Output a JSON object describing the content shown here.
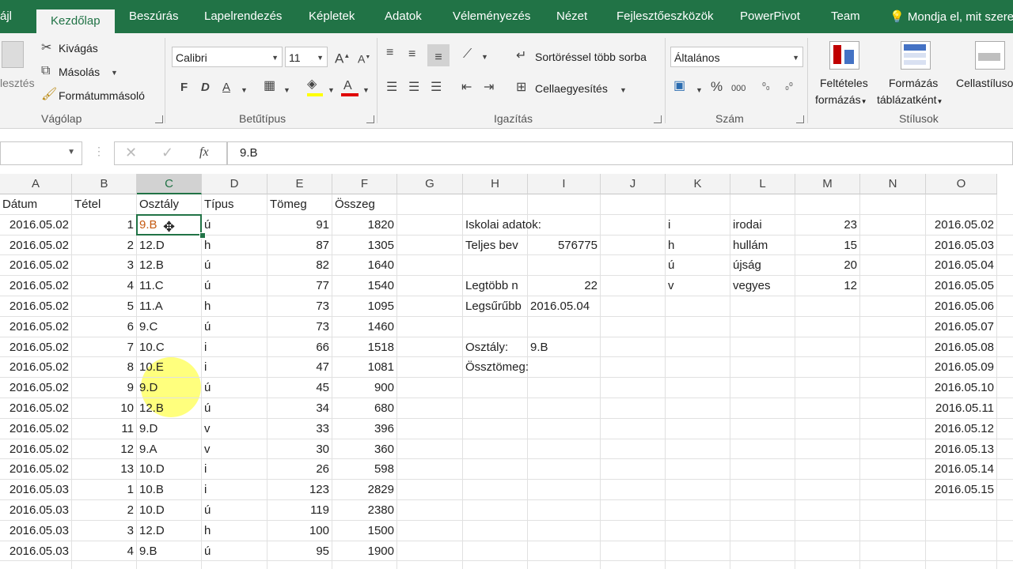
{
  "tabs": [
    "ájl",
    "Kezdőlap",
    "Beszúrás",
    "Lapelrendezés",
    "Képletek",
    "Adatok",
    "Véleményezés",
    "Nézet",
    "Fejlesztőeszközök",
    "PowerPivot",
    "Team"
  ],
  "tell_me": "Mondja el, mit szere",
  "clipboard": {
    "paste": "lesztés",
    "cut": "Kivágás",
    "copy": "Másolás",
    "format_painter": "Formátummásoló",
    "group": "Vágólap"
  },
  "font": {
    "name": "Calibri",
    "size": "11",
    "bold": "F",
    "italic": "D",
    "underline": "A",
    "group": "Betűtípus"
  },
  "alignment": {
    "wrap": "Sortöréssel több sorba",
    "merge": "Cellaegyesítés",
    "group": "Igazítás"
  },
  "number": {
    "format": "Általános",
    "percent": "%",
    "thousands": "000",
    "group": "Szám"
  },
  "styles": {
    "conditional_1": "Feltételes",
    "conditional_2": "formázás",
    "table_1": "Formázás",
    "table_2": "táblázatként",
    "cell": "Cellastílusok",
    "group": "Stílusok"
  },
  "formula_bar": {
    "fx": "fx",
    "value": "9.B"
  },
  "columns": [
    "A",
    "B",
    "C",
    "D",
    "E",
    "F",
    "G",
    "H",
    "I",
    "J",
    "K",
    "L",
    "M",
    "N",
    "O"
  ],
  "selected_column": "C",
  "headers": {
    "A": "Dátum",
    "B": "Tétel",
    "C": "Osztály",
    "D": "Típus",
    "E": "Tömeg",
    "F": "Összeg"
  },
  "rows": [
    [
      "2016.05.02",
      "1",
      "9.B",
      "ú",
      "91",
      "1820"
    ],
    [
      "2016.05.02",
      "2",
      "12.D",
      "h",
      "87",
      "1305"
    ],
    [
      "2016.05.02",
      "3",
      "12.B",
      "ú",
      "82",
      "1640"
    ],
    [
      "2016.05.02",
      "4",
      "11.C",
      "ú",
      "77",
      "1540"
    ],
    [
      "2016.05.02",
      "5",
      "11.A",
      "h",
      "73",
      "1095"
    ],
    [
      "2016.05.02",
      "6",
      "9.C",
      "ú",
      "73",
      "1460"
    ],
    [
      "2016.05.02",
      "7",
      "10.C",
      "i",
      "66",
      "1518"
    ],
    [
      "2016.05.02",
      "8",
      "10.E",
      "i",
      "47",
      "1081"
    ],
    [
      "2016.05.02",
      "9",
      "9.D",
      "ú",
      "45",
      "900"
    ],
    [
      "2016.05.02",
      "10",
      "12.B",
      "ú",
      "34",
      "680"
    ],
    [
      "2016.05.02",
      "11",
      "9.D",
      "v",
      "33",
      "396"
    ],
    [
      "2016.05.02",
      "12",
      "9.A",
      "v",
      "30",
      "360"
    ],
    [
      "2016.05.02",
      "13",
      "10.D",
      "i",
      "26",
      "598"
    ],
    [
      "2016.05.03",
      "1",
      "10.B",
      "i",
      "123",
      "2829"
    ],
    [
      "2016.05.03",
      "2",
      "10.D",
      "ú",
      "119",
      "2380"
    ],
    [
      "2016.05.03",
      "3",
      "12.D",
      "h",
      "100",
      "1500"
    ],
    [
      "2016.05.03",
      "4",
      "9.B",
      "ú",
      "95",
      "1900"
    ]
  ],
  "side_info": {
    "school_label": "Iskolai adatok:",
    "total_label": "Teljes bev",
    "total_value": "576775",
    "most_label": "Legtöbb n",
    "most_value": "22",
    "densest_label": "Legsűrűbb",
    "densest_value": "2016.05.04",
    "class_label": "Osztály:",
    "class_value": "9.B",
    "mass_label": "Össztömeg:"
  },
  "types": [
    [
      "i",
      "irodai",
      "23"
    ],
    [
      "h",
      "hullám",
      "15"
    ],
    [
      "ú",
      "újság",
      "20"
    ],
    [
      "v",
      "vegyes",
      "12"
    ]
  ],
  "dates_o": [
    "2016.05.02",
    "2016.05.03",
    "2016.05.04",
    "2016.05.05",
    "2016.05.06",
    "2016.05.07",
    "2016.05.08",
    "2016.05.09",
    "2016.05.10",
    "2016.05.11",
    "2016.05.12",
    "2016.05.13",
    "2016.05.14",
    "2016.05.15"
  ],
  "colors": {
    "excel_green": "#217346",
    "highlight": "#ffff66",
    "orange_text": "#c55a11"
  }
}
